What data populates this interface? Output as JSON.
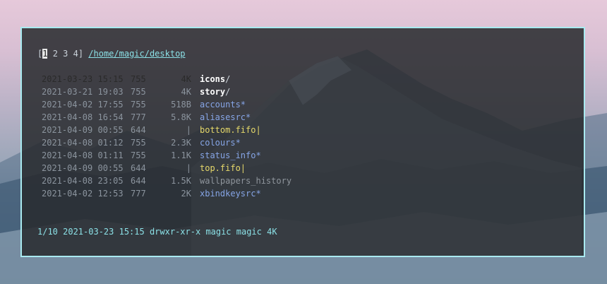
{
  "terminal": {
    "tabs": {
      "open_bracket": "[",
      "active": "1",
      "rest": " 2 3 4] ",
      "path": "/home/magic/desktop"
    },
    "entries": [
      {
        "date": "2021-03-23 15:15",
        "perm": "755",
        "size": "4K",
        "name": "icons",
        "suffix": "/",
        "type": "dir",
        "selected": true
      },
      {
        "date": "2021-03-21 19:03",
        "perm": "755",
        "size": "4K",
        "name": "story",
        "suffix": "/",
        "type": "dir",
        "selected": false
      },
      {
        "date": "2021-04-02 17:55",
        "perm": "755",
        "size": "518B",
        "name": "accounts",
        "suffix": "*",
        "type": "exe",
        "selected": false
      },
      {
        "date": "2021-04-08 16:54",
        "perm": "777",
        "size": "5.8K",
        "name": "aliasesrc",
        "suffix": "*",
        "type": "exe",
        "selected": false
      },
      {
        "date": "2021-04-09 00:55",
        "perm": "644",
        "size": "|",
        "name": "bottom.fifo",
        "suffix": "|",
        "type": "fifo",
        "selected": false
      },
      {
        "date": "2021-04-08 01:12",
        "perm": "755",
        "size": "2.3K",
        "name": "colours",
        "suffix": "*",
        "type": "exe",
        "selected": false
      },
      {
        "date": "2021-04-08 01:11",
        "perm": "755",
        "size": "1.1K",
        "name": "status_info",
        "suffix": "*",
        "type": "exe",
        "selected": false
      },
      {
        "date": "2021-04-09 00:55",
        "perm": "644",
        "size": "|",
        "name": "top.fifo",
        "suffix": "|",
        "type": "fifo",
        "selected": false
      },
      {
        "date": "2021-04-08 23:05",
        "perm": "644",
        "size": "1.5K",
        "name": "wallpapers_history",
        "suffix": "",
        "type": "plain",
        "selected": false
      },
      {
        "date": "2021-04-02 12:53",
        "perm": "777",
        "size": "2K",
        "name": "xbindkeysrc",
        "suffix": "*",
        "type": "exe",
        "selected": false
      }
    ],
    "status_line": "1/10 2021-03-23 15:15 drwxr-xr-x magic magic 4K"
  },
  "colors": {
    "border": "#a9eaf0",
    "path": "#8be0e6",
    "dir": "#ffffff",
    "executable": "#86a5e6",
    "fifo": "#e6d86a",
    "plain": "#8e959c",
    "selection": "#c7c7c7"
  }
}
